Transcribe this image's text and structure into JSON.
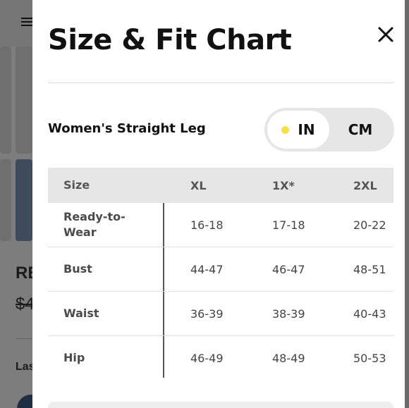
{
  "modal": {
    "title": "Size & Fit Chart",
    "fit_label": "Women's Straight Leg",
    "units": {
      "options": [
        "IN",
        "CM"
      ],
      "selected": "IN"
    }
  },
  "table": {
    "headers": [
      "Size",
      "XL",
      "1X*",
      "2XL"
    ],
    "rows": [
      {
        "label": "Ready-to-Wear",
        "values": [
          "16-18",
          "17-18",
          "20-22"
        ]
      },
      {
        "label": "Bust",
        "values": [
          "44-47",
          "46-47",
          "48-51"
        ]
      },
      {
        "label": "Waist",
        "values": [
          "36-39",
          "38-39",
          "40-43"
        ]
      },
      {
        "label": "Hip",
        "values": [
          "46-49",
          "48-49",
          "50-53"
        ]
      }
    ]
  },
  "background": {
    "text_re": "RE",
    "text_price": "$4",
    "text_las": "Las"
  },
  "icons": {
    "close": "close-icon",
    "menu": "hamburger-menu-icon",
    "selected_dot": "dot-icon"
  },
  "colors": {
    "dot": "#f7e04a",
    "toggle_bg": "#e6e6e6",
    "header_bg": "#e6e6e6"
  }
}
